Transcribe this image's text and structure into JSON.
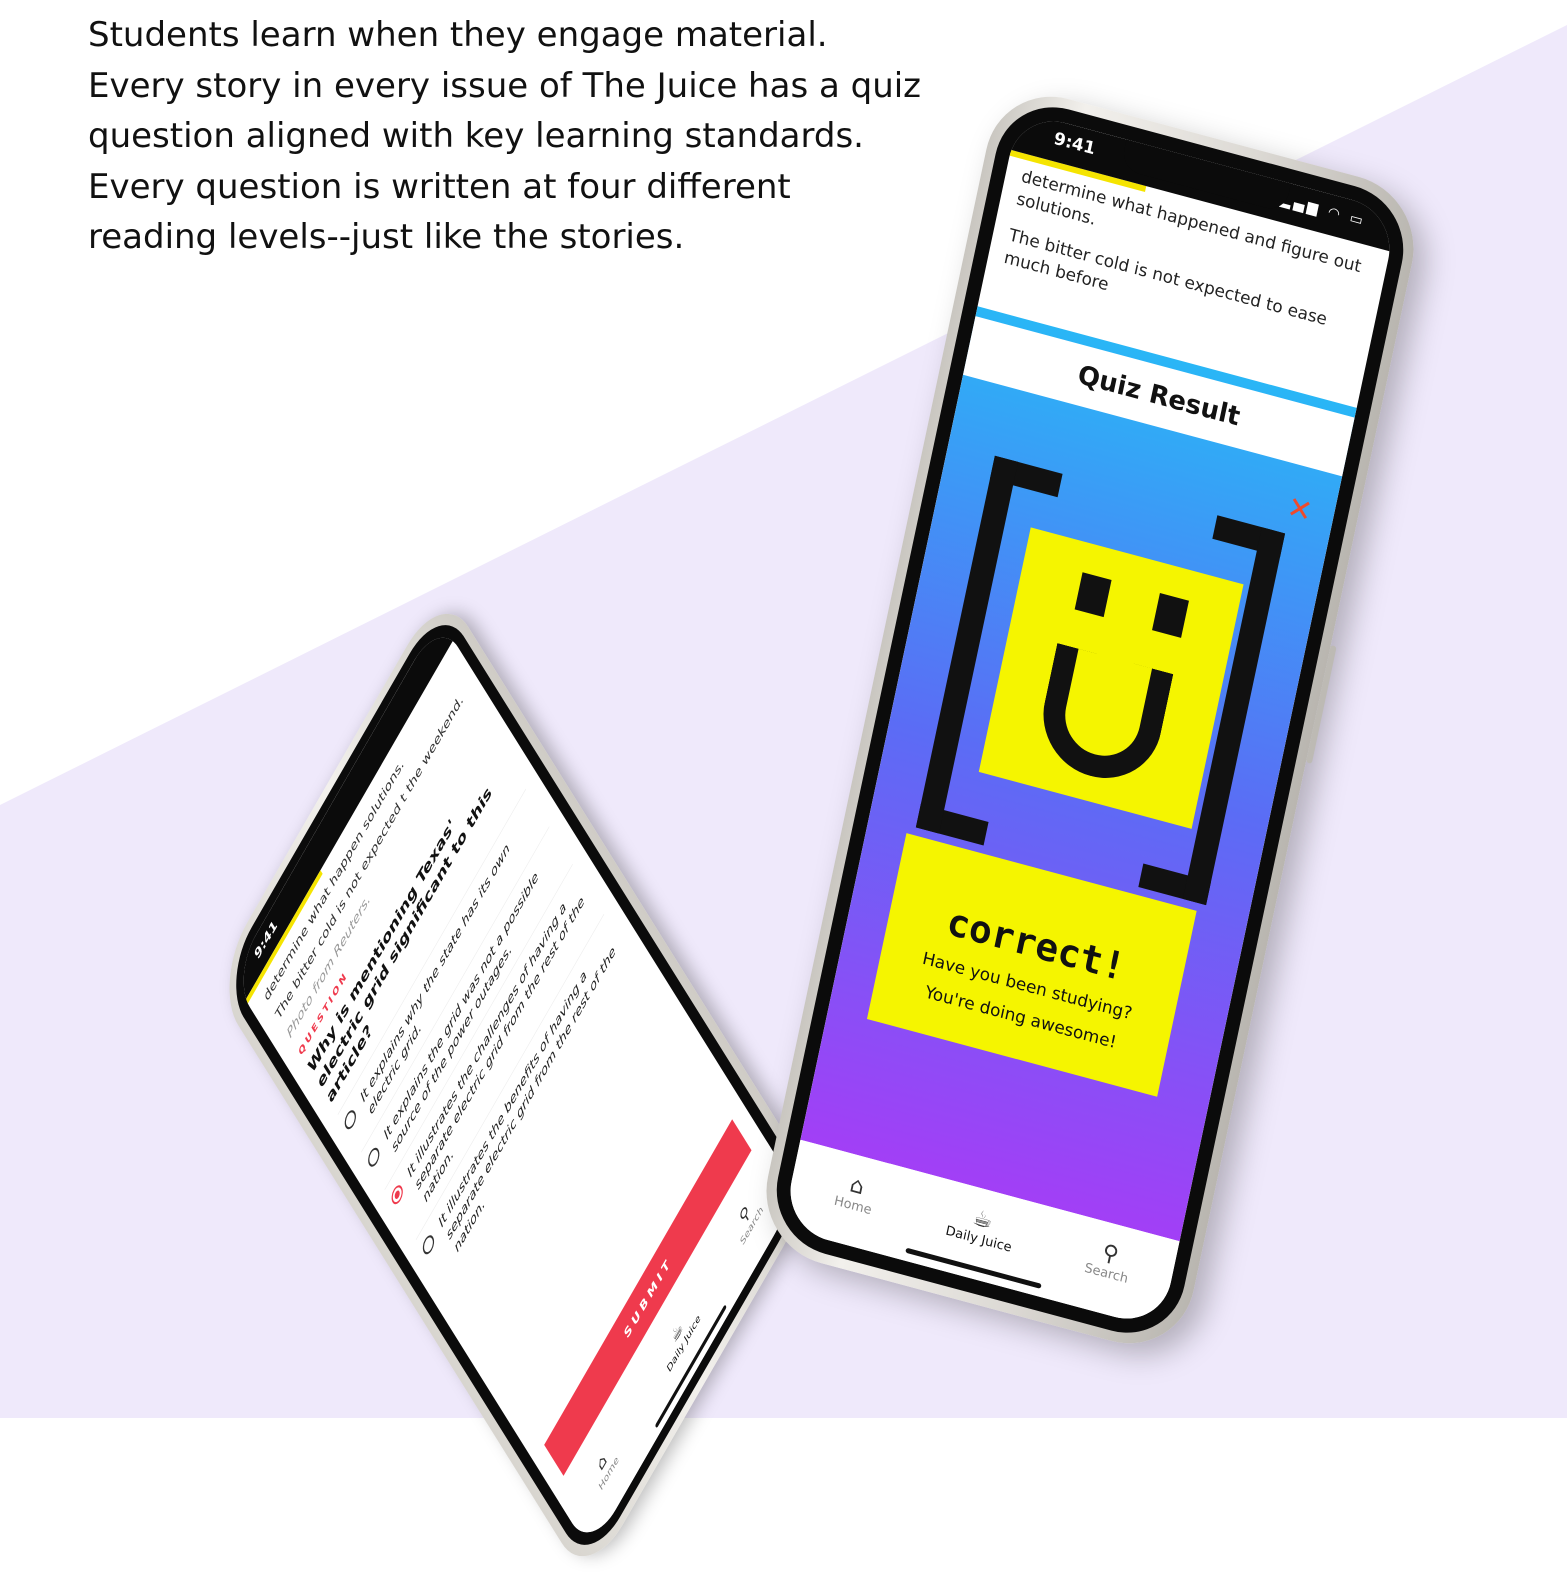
{
  "intro": {
    "lines": [
      "Students learn when they engage material.",
      "Every story in every issue of The Juice has a quiz",
      "question aligned with key learning standards.",
      "Every question is written at four different",
      "reading levels--just like the stories."
    ]
  },
  "colors": {
    "band": "#efe9fb",
    "accent_red": "#ef3a4d",
    "close_orange": "#ef4a2b",
    "yellow": "#f5f500",
    "gradient_top": "#29b6f6",
    "gradient_bottom": "#a23ff6"
  },
  "quiz_result_phone": {
    "status_time": "9:41",
    "status_icons": "signal-wifi-battery-icons",
    "article": {
      "p1": "determine what happened and figure out solutions.",
      "p2": "The bitter cold is not expected to ease much before"
    },
    "header_title": "Quiz Result",
    "close_icon": "close-icon",
    "result_title": "correct!",
    "result_message_1": "Have you been studying?",
    "result_message_2": "You're doing awesome!",
    "nav": {
      "home_label": "Home",
      "daily_juice_label": "Daily Juice",
      "search_label": "Search"
    }
  },
  "quiz_phone": {
    "status_time": "9:41",
    "article": {
      "p1": "determine what happen solutions.",
      "p2": "The bitter cold is not expected t the weekend.",
      "credit": "Photo from Reuters."
    },
    "question_label": "QUESTION",
    "question_text": "Why is mentioning Texas' electric grid significant to this article?",
    "options": [
      {
        "text": "It explains why the state has its own electric grid.",
        "selected": false
      },
      {
        "text": "It explains the grid was not a possible source of the power outages.",
        "selected": false
      },
      {
        "text": "It illustrates the challenges of having a separate electric grid from the rest of the nation.",
        "selected": true
      },
      {
        "text": "It illustrates the benefits of having a separate electric grid from the rest of the nation.",
        "selected": false
      }
    ],
    "submit_label": "SUBMIT",
    "nav": {
      "home_label": "Home",
      "daily_juice_label": "Daily Juice",
      "search_label": "Search"
    }
  }
}
